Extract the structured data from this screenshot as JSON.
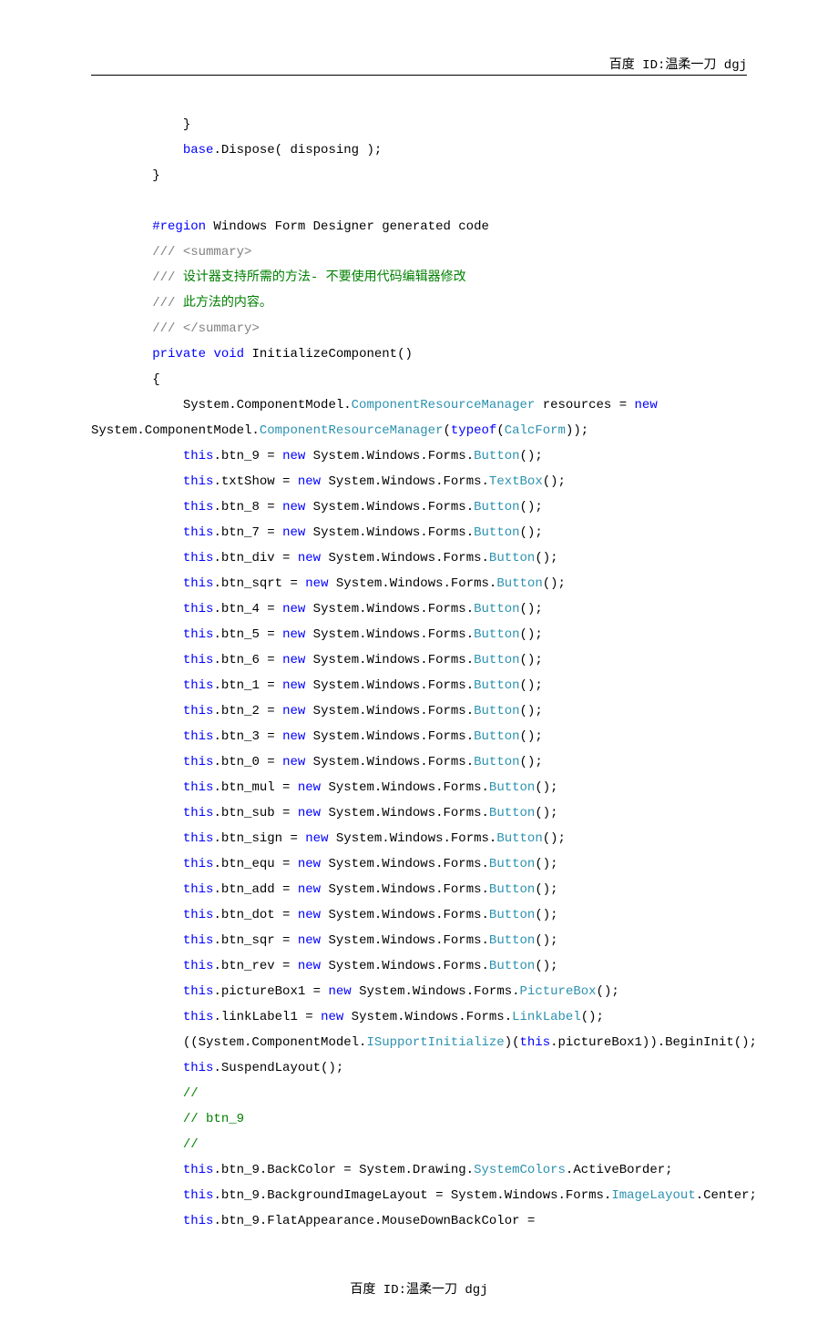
{
  "header": "百度 ID:温柔一刀 dgj",
  "footer": "百度 ID:温柔一刀 dgj",
  "code": {
    "l1": "            }",
    "l2a": "            ",
    "l2b": "base",
    "l2c": ".Dispose( disposing );",
    "l3": "        }",
    "l4": "",
    "l5a": "        ",
    "l5b": "#region",
    "l5c": " Windows Form Designer generated code",
    "l6a": "        ",
    "l6b": "/// ",
    "l6c": "<summary>",
    "l7a": "        ",
    "l7b": "///",
    "l7c": " 设计器支持所需的方法- 不要使用代码编辑器修改",
    "l8a": "        ",
    "l8b": "///",
    "l8c": " 此方法的内容。",
    "l9a": "        ",
    "l9b": "/// ",
    "l9c": "</summary>",
    "l10a": "        ",
    "l10b": "private",
    "l10c": " ",
    "l10d": "void",
    "l10e": " InitializeComponent()",
    "l11": "        {",
    "l12a": "            System.ComponentModel.",
    "l12b": "ComponentResourceManager",
    "l12c": " resources = ",
    "l12d": "new",
    "l13a": "System.ComponentModel.",
    "l13b": "ComponentResourceManager",
    "l13c": "(",
    "l13d": "typeof",
    "l13e": "(",
    "l13f": "CalcForm",
    "l13g": "));",
    "l14a": "            ",
    "l14b": "this",
    "l14c": ".btn_9 = ",
    "l14d": "new",
    "l14e": " System.Windows.Forms.",
    "l14f": "Button",
    "l14g": "();",
    "l15a": "            ",
    "l15b": "this",
    "l15c": ".txtShow = ",
    "l15d": "new",
    "l15e": " System.Windows.Forms.",
    "l15f": "TextBox",
    "l15g": "();",
    "l16a": "            ",
    "l16b": "this",
    "l16c": ".btn_8 = ",
    "l16d": "new",
    "l16e": " System.Windows.Forms.",
    "l16f": "Button",
    "l16g": "();",
    "l17a": "            ",
    "l17b": "this",
    "l17c": ".btn_7 = ",
    "l17d": "new",
    "l17e": " System.Windows.Forms.",
    "l17f": "Button",
    "l17g": "();",
    "l18a": "            ",
    "l18b": "this",
    "l18c": ".btn_div = ",
    "l18d": "new",
    "l18e": " System.Windows.Forms.",
    "l18f": "Button",
    "l18g": "();",
    "l19a": "            ",
    "l19b": "this",
    "l19c": ".btn_sqrt = ",
    "l19d": "new",
    "l19e": " System.Windows.Forms.",
    "l19f": "Button",
    "l19g": "();",
    "l20a": "            ",
    "l20b": "this",
    "l20c": ".btn_4 = ",
    "l20d": "new",
    "l20e": " System.Windows.Forms.",
    "l20f": "Button",
    "l20g": "();",
    "l21a": "            ",
    "l21b": "this",
    "l21c": ".btn_5 = ",
    "l21d": "new",
    "l21e": " System.Windows.Forms.",
    "l21f": "Button",
    "l21g": "();",
    "l22a": "            ",
    "l22b": "this",
    "l22c": ".btn_6 = ",
    "l22d": "new",
    "l22e": " System.Windows.Forms.",
    "l22f": "Button",
    "l22g": "();",
    "l23a": "            ",
    "l23b": "this",
    "l23c": ".btn_1 = ",
    "l23d": "new",
    "l23e": " System.Windows.Forms.",
    "l23f": "Button",
    "l23g": "();",
    "l24a": "            ",
    "l24b": "this",
    "l24c": ".btn_2 = ",
    "l24d": "new",
    "l24e": " System.Windows.Forms.",
    "l24f": "Button",
    "l24g": "();",
    "l25a": "            ",
    "l25b": "this",
    "l25c": ".btn_3 = ",
    "l25d": "new",
    "l25e": " System.Windows.Forms.",
    "l25f": "Button",
    "l25g": "();",
    "l26a": "            ",
    "l26b": "this",
    "l26c": ".btn_0 = ",
    "l26d": "new",
    "l26e": " System.Windows.Forms.",
    "l26f": "Button",
    "l26g": "();",
    "l27a": "            ",
    "l27b": "this",
    "l27c": ".btn_mul = ",
    "l27d": "new",
    "l27e": " System.Windows.Forms.",
    "l27f": "Button",
    "l27g": "();",
    "l28a": "            ",
    "l28b": "this",
    "l28c": ".btn_sub = ",
    "l28d": "new",
    "l28e": " System.Windows.Forms.",
    "l28f": "Button",
    "l28g": "();",
    "l29a": "            ",
    "l29b": "this",
    "l29c": ".btn_sign = ",
    "l29d": "new",
    "l29e": " System.Windows.Forms.",
    "l29f": "Button",
    "l29g": "();",
    "l30a": "            ",
    "l30b": "this",
    "l30c": ".btn_equ = ",
    "l30d": "new",
    "l30e": " System.Windows.Forms.",
    "l30f": "Button",
    "l30g": "();",
    "l31a": "            ",
    "l31b": "this",
    "l31c": ".btn_add = ",
    "l31d": "new",
    "l31e": " System.Windows.Forms.",
    "l31f": "Button",
    "l31g": "();",
    "l32a": "            ",
    "l32b": "this",
    "l32c": ".btn_dot = ",
    "l32d": "new",
    "l32e": " System.Windows.Forms.",
    "l32f": "Button",
    "l32g": "();",
    "l33a": "            ",
    "l33b": "this",
    "l33c": ".btn_sqr = ",
    "l33d": "new",
    "l33e": " System.Windows.Forms.",
    "l33f": "Button",
    "l33g": "();",
    "l34a": "            ",
    "l34b": "this",
    "l34c": ".btn_rev = ",
    "l34d": "new",
    "l34e": " System.Windows.Forms.",
    "l34f": "Button",
    "l34g": "();",
    "l35a": "            ",
    "l35b": "this",
    "l35c": ".pictureBox1 = ",
    "l35d": "new",
    "l35e": " System.Windows.Forms.",
    "l35f": "PictureBox",
    "l35g": "();",
    "l36a": "            ",
    "l36b": "this",
    "l36c": ".linkLabel1 = ",
    "l36d": "new",
    "l36e": " System.Windows.Forms.",
    "l36f": "LinkLabel",
    "l36g": "();",
    "l37a": "            ((System.ComponentModel.",
    "l37b": "ISupportInitialize",
    "l37c": ")(",
    "l37d": "this",
    "l37e": ".pictureBox1)).BeginInit();",
    "l38a": "            ",
    "l38b": "this",
    "l38c": ".SuspendLayout();",
    "l39a": "            ",
    "l39b": "//",
    "l40a": "            ",
    "l40b": "// btn_9",
    "l41a": "            ",
    "l41b": "//",
    "l42a": "            ",
    "l42b": "this",
    "l42c": ".btn_9.BackColor = System.Drawing.",
    "l42d": "SystemColors",
    "l42e": ".ActiveBorder;",
    "l43a": "            ",
    "l43b": "this",
    "l43c": ".btn_9.BackgroundImageLayout = System.Windows.Forms.",
    "l43d": "ImageLayout",
    "l43e": ".Center;",
    "l44a": "            ",
    "l44b": "this",
    "l44c": ".btn_9.FlatAppearance.MouseDownBackColor ="
  }
}
